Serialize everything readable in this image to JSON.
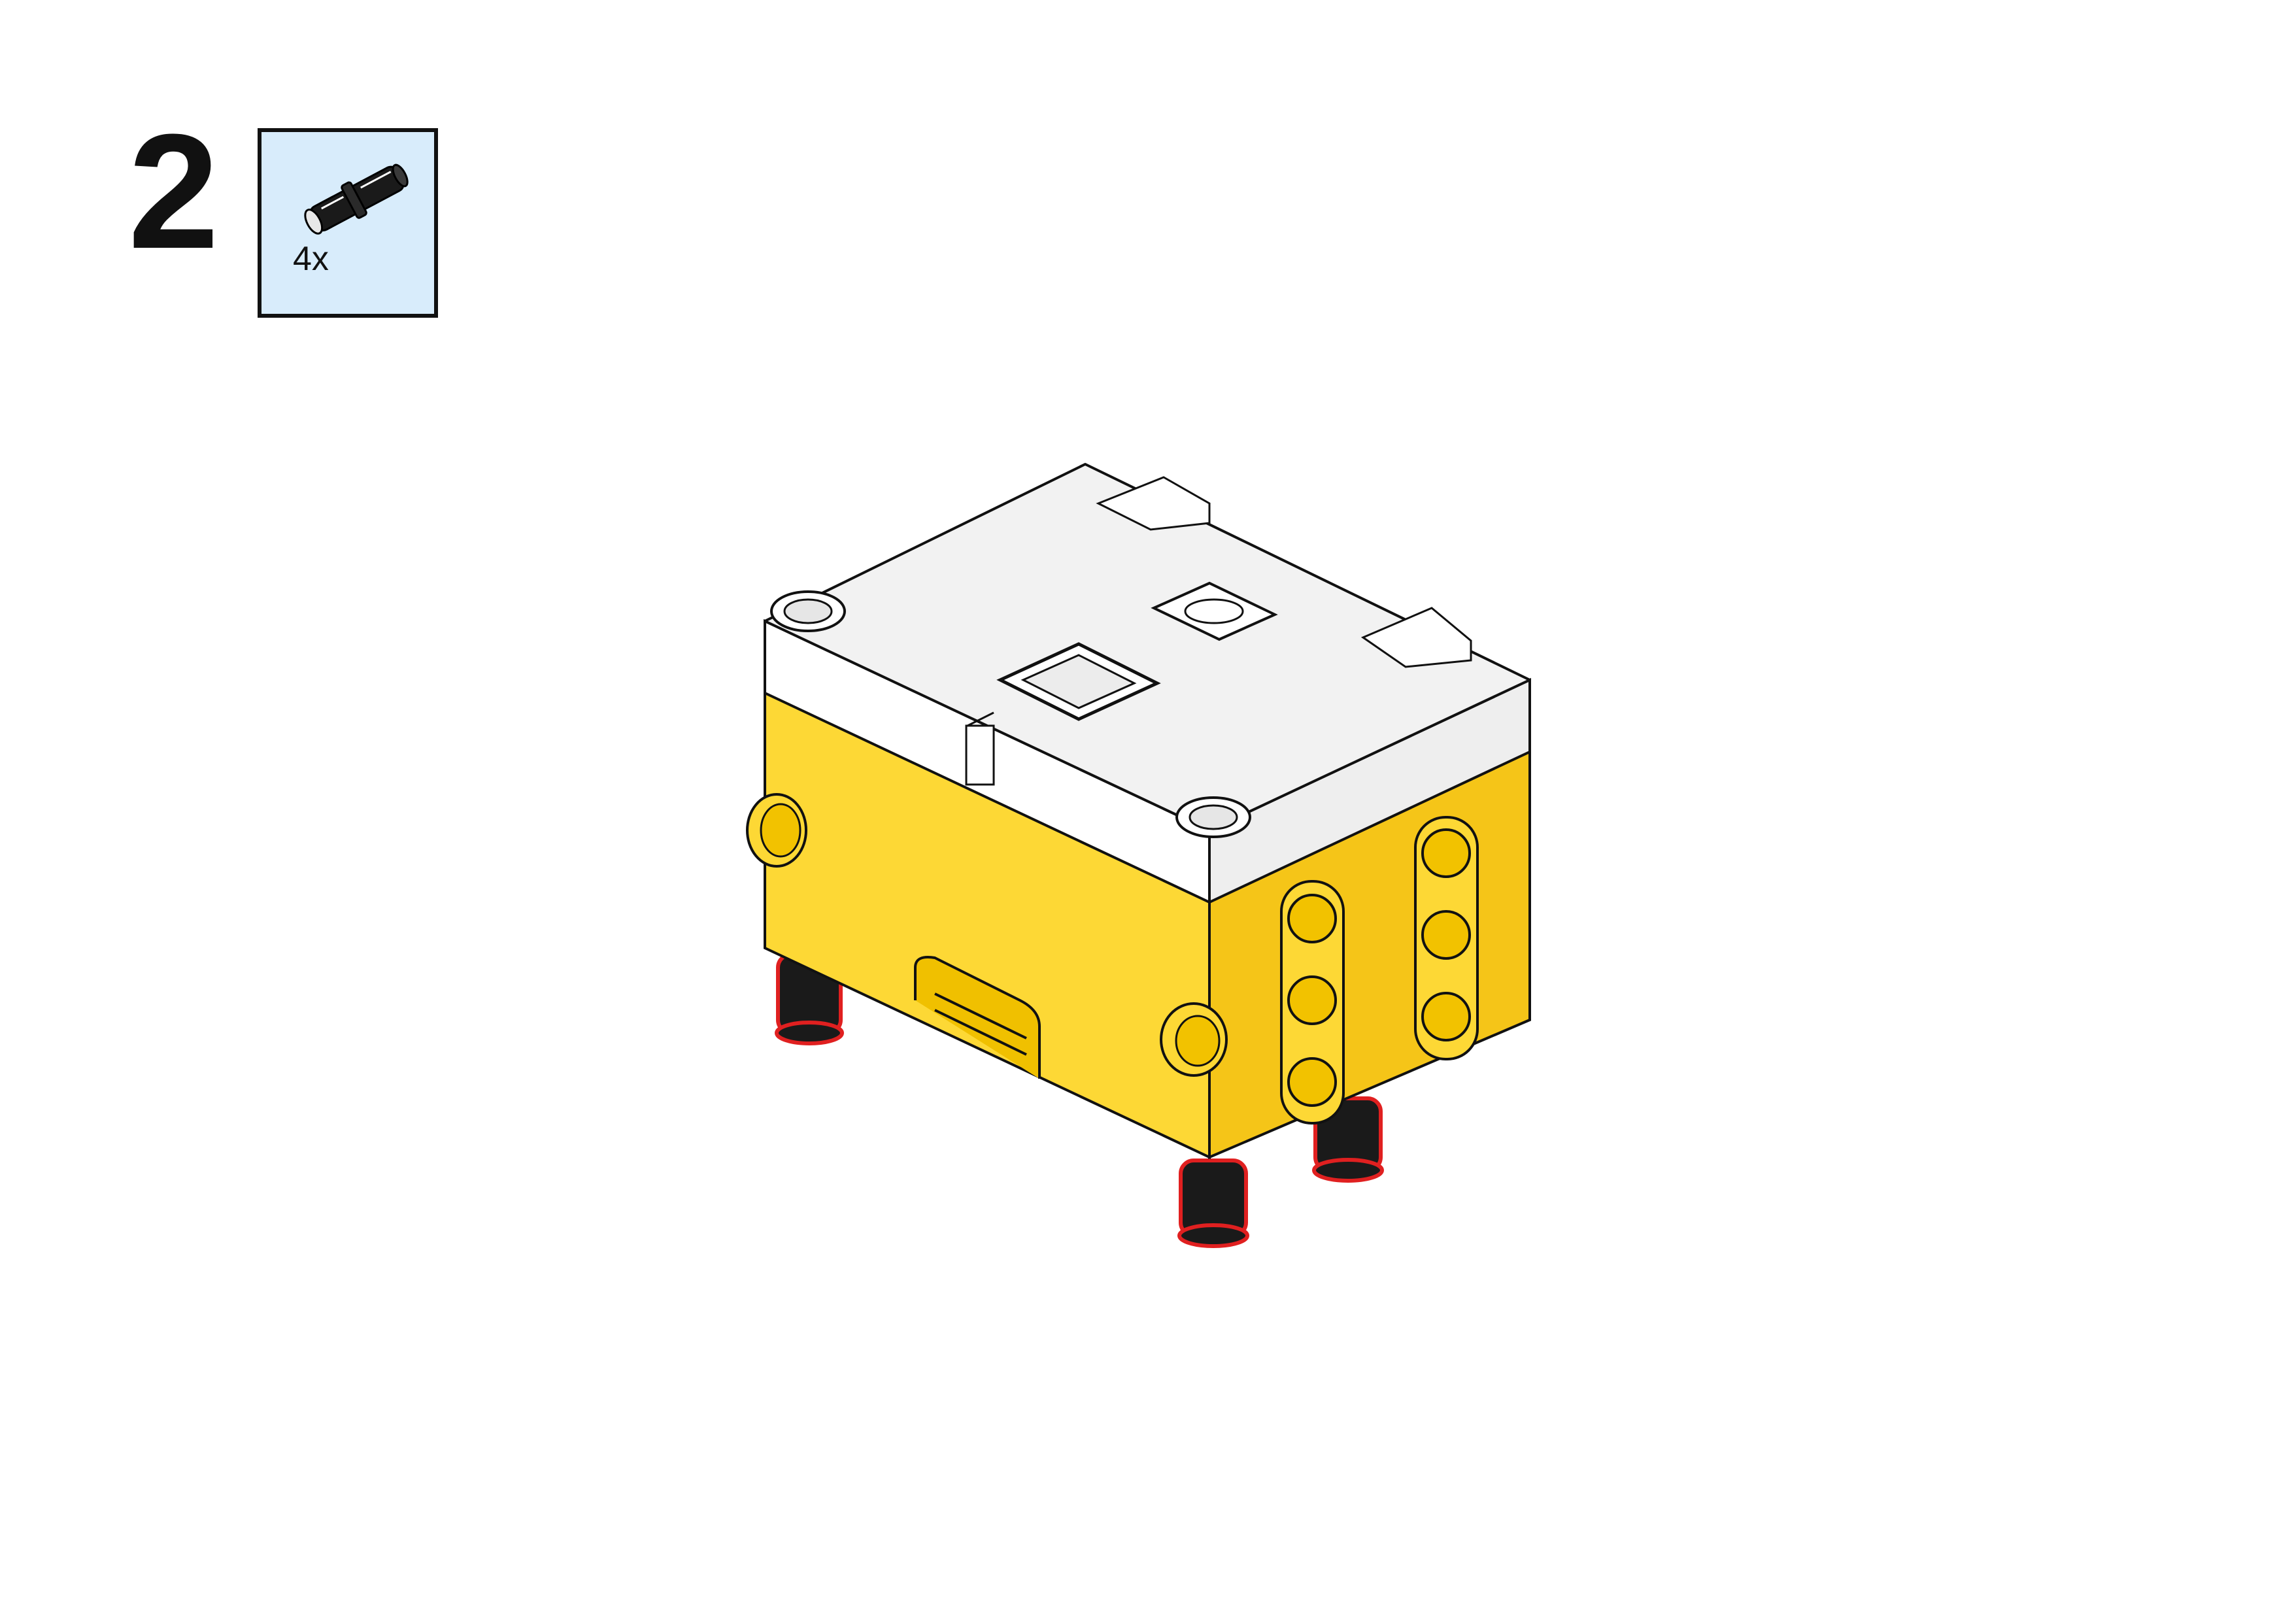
{
  "step": {
    "number": "2"
  },
  "parts_callout": {
    "parts": [
      {
        "name": "connector-peg-black-icon",
        "quantity": "4x",
        "color": "#1a1a1a"
      }
    ],
    "background_color": "#d8ecfb"
  },
  "model": {
    "description_icon": "hub-assembly-icon",
    "colors": {
      "top": "#f2f2f2",
      "body": "#fdd835",
      "body_shade": "#f5c518",
      "peg": "#1a1a1a",
      "highlight": "#e02020"
    },
    "new_parts_count": 4
  }
}
